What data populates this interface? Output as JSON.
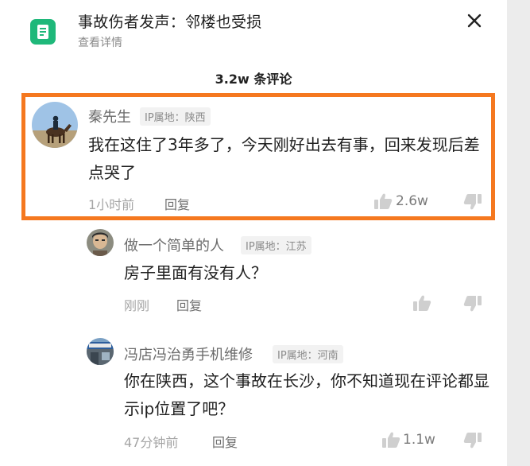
{
  "header": {
    "title": "事故伤者发声：邻楼也受损",
    "subtitle": "查看详情",
    "doc_icon": "document-icon",
    "close_icon": "close-icon"
  },
  "comment_count": "3.2w 条评论",
  "colors": {
    "highlight": "#f5781f",
    "doc_icon_bg": "#1fb87a"
  },
  "comments": [
    {
      "username": "秦先生",
      "ip": "IP属地：陕西",
      "text": "我在这住了3年多了，今天刚好出去有事，回来发现后差点哭了",
      "time": "1小时前",
      "reply": "回复",
      "likes": "2.6w",
      "avatar": "avatar-horse-rider"
    },
    {
      "username": "做一个简单的人",
      "ip": "IP属地：江苏",
      "text": "房子里面有没有人？",
      "time": "刚刚",
      "reply": "回复",
      "likes": "",
      "avatar": "avatar-person"
    },
    {
      "username": "冯店冯治勇手机维修",
      "ip": "IP属地：河南",
      "text": "你在陕西，这个事故在长沙，你不知道现在评论都显示ip位置了吧？",
      "time": "47分钟前",
      "reply": "回复",
      "likes": "1.1w",
      "avatar": "avatar-storefront"
    }
  ]
}
